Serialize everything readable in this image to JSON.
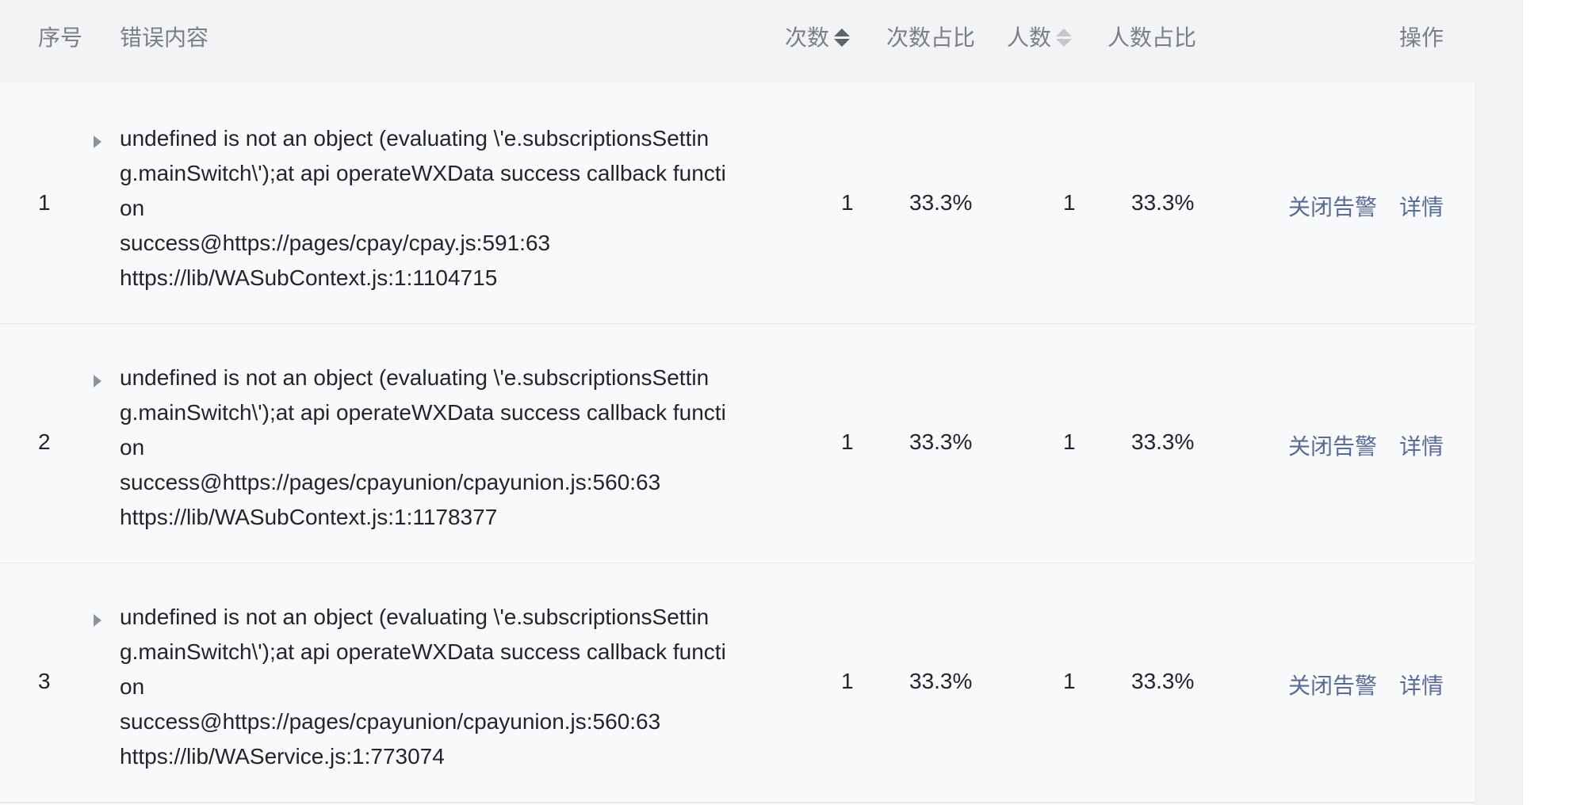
{
  "table": {
    "headers": {
      "index": "序号",
      "error": "错误内容",
      "count": "次数",
      "count_ratio": "次数占比",
      "users": "人数",
      "users_ratio": "人数占比",
      "actions": "操作"
    },
    "rows": [
      {
        "index": "1",
        "message": "undefined is not an object (evaluating \\'e.subscriptionsSettin\ng.mainSwitch\\');at api operateWXData success callback functi\non\nsuccess@https://pages/cpay/cpay.js:591:63\nhttps://lib/WASubContext.js:1:1104715",
        "count": "1",
        "count_ratio": "33.3%",
        "users": "1",
        "users_ratio": "33.3%",
        "close_alert": "关闭告警",
        "detail": "详情"
      },
      {
        "index": "2",
        "message": "undefined is not an object (evaluating \\'e.subscriptionsSettin\ng.mainSwitch\\');at api operateWXData success callback functi\non\nsuccess@https://pages/cpayunion/cpayunion.js:560:63\nhttps://lib/WASubContext.js:1:1178377",
        "count": "1",
        "count_ratio": "33.3%",
        "users": "1",
        "users_ratio": "33.3%",
        "close_alert": "关闭告警",
        "detail": "详情"
      },
      {
        "index": "3",
        "message": "undefined is not an object (evaluating \\'e.subscriptionsSettin\ng.mainSwitch\\');at api operateWXData success callback functi\non\nsuccess@https://pages/cpayunion/cpayunion.js:560:63\nhttps://lib/WAService.js:1:773074",
        "count": "1",
        "count_ratio": "33.3%",
        "users": "1",
        "users_ratio": "33.3%",
        "close_alert": "关闭告警",
        "detail": "详情"
      }
    ]
  },
  "icons": {
    "sort_count": "sort-icon",
    "sort_users": "sort-icon",
    "expand": "triangle-right-icon"
  }
}
